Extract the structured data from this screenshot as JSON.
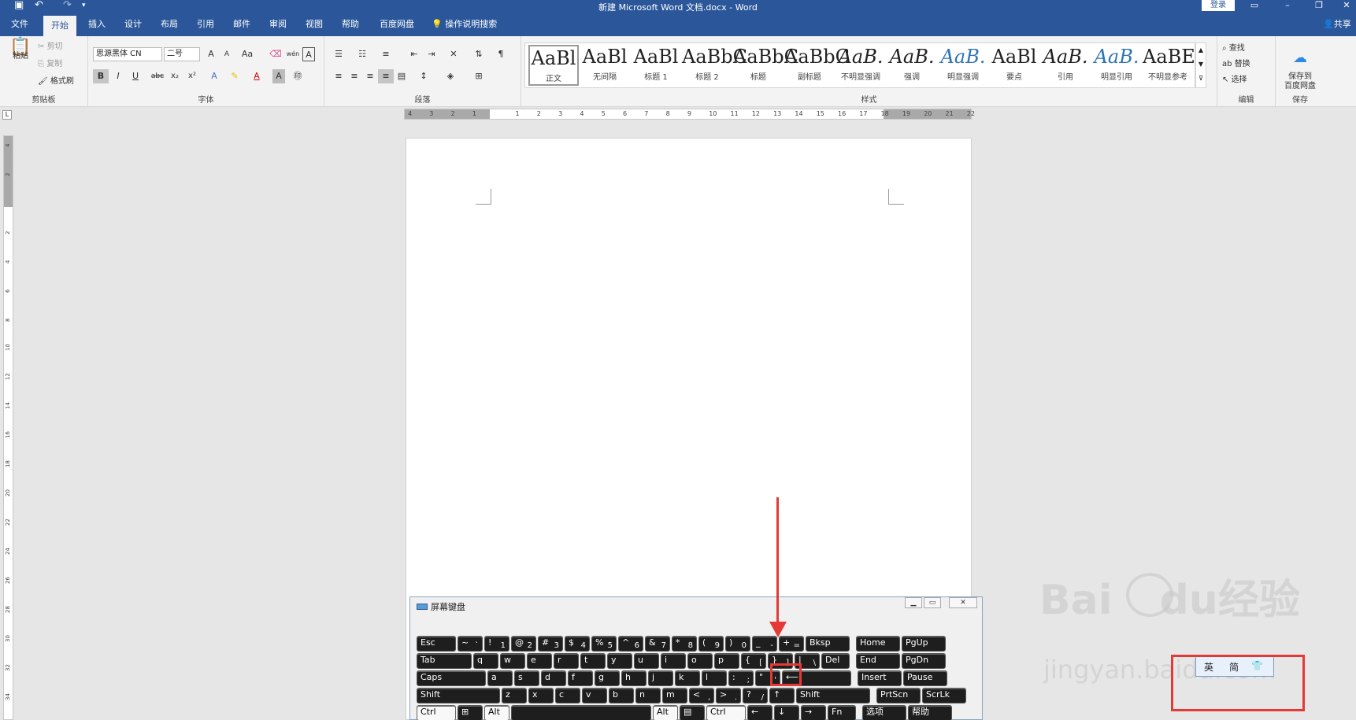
{
  "titlebar": {
    "title": "新建 Microsoft Word 文档.docx  -  Word",
    "login": "登录",
    "qat_icons": [
      "save-icon",
      "undo-icon",
      "redo-icon",
      "customize-icon"
    ]
  },
  "tabs": [
    {
      "label": "文件",
      "active": false
    },
    {
      "label": "开始",
      "active": true
    },
    {
      "label": "插入",
      "active": false
    },
    {
      "label": "设计",
      "active": false
    },
    {
      "label": "布局",
      "active": false
    },
    {
      "label": "引用",
      "active": false
    },
    {
      "label": "邮件",
      "active": false
    },
    {
      "label": "审阅",
      "active": false
    },
    {
      "label": "视图",
      "active": false
    },
    {
      "label": "帮助",
      "active": false
    },
    {
      "label": "百度网盘",
      "active": false
    }
  ],
  "tellme": "操作说明搜索",
  "share": "共享",
  "ribbon": {
    "clipboard": {
      "paste": "粘贴",
      "cut": "剪切",
      "copy": "复制",
      "format_painter": "格式刷",
      "label": "剪贴板"
    },
    "font": {
      "name": "思源黑体 CN",
      "size": "二号",
      "label": "字体",
      "bold": "B",
      "italic": "I",
      "underline": "U",
      "strike": "abc",
      "sub": "x₂",
      "sup": "x²",
      "change_case": "Aa",
      "phonetic": "wén",
      "grow": "A",
      "shrink": "A"
    },
    "paragraph": {
      "label": "段落"
    },
    "styles": {
      "label": "样式",
      "items": [
        {
          "sample": "AaBl",
          "name": "正文",
          "selected": true,
          "variant": "normal"
        },
        {
          "sample": "AaBl",
          "name": "无间隔",
          "selected": false,
          "variant": "normal"
        },
        {
          "sample": "AaBl",
          "name": "标题 1",
          "selected": false,
          "variant": "normal"
        },
        {
          "sample": "AaBbC",
          "name": "标题 2",
          "selected": false,
          "variant": "normal"
        },
        {
          "sample": "AaBbC",
          "name": "标题",
          "selected": false,
          "variant": "normal"
        },
        {
          "sample": "AaBbC",
          "name": "副标题",
          "selected": false,
          "variant": "normal"
        },
        {
          "sample": "AaB.",
          "name": "不明显强调",
          "selected": false,
          "variant": "ital"
        },
        {
          "sample": "AaB.",
          "name": "强调",
          "selected": false,
          "variant": "ital"
        },
        {
          "sample": "AaB.",
          "name": "明显强调",
          "selected": false,
          "variant": "blue"
        },
        {
          "sample": "AaBl",
          "name": "要点",
          "selected": false,
          "variant": "normal"
        },
        {
          "sample": "AaB.",
          "name": "引用",
          "selected": false,
          "variant": "ital"
        },
        {
          "sample": "AaB.",
          "name": "明显引用",
          "selected": false,
          "variant": "blue"
        },
        {
          "sample": "AaBE",
          "name": "不明显参考",
          "selected": false,
          "variant": "normal"
        }
      ]
    },
    "editing": {
      "find": "查找",
      "replace": "替换",
      "select": "选择",
      "label": "编辑"
    },
    "save": {
      "button": "保存到\n百度网盘",
      "label": "保存"
    }
  },
  "ruler": {
    "h_ticks": [
      "4",
      "3",
      "2",
      "1",
      "",
      "1",
      "2",
      "3",
      "4",
      "5",
      "6",
      "7",
      "8",
      "9",
      "10",
      "11",
      "12",
      "13",
      "14",
      "15",
      "16",
      "17",
      "18",
      "19",
      "20",
      "21",
      "22"
    ],
    "v_ticks": [
      "4",
      "2",
      "",
      "2",
      "4",
      "6",
      "8",
      "10",
      "12",
      "14",
      "16",
      "18",
      "20",
      "22",
      "24",
      "26",
      "28",
      "30",
      "32",
      "34"
    ]
  },
  "osk": {
    "title": "屏幕键盘",
    "rows": [
      [
        {
          "m": "Esc"
        },
        {
          "t": "~",
          "m": "`"
        },
        {
          "t": "!",
          "m": "1"
        },
        {
          "t": "@",
          "m": "2"
        },
        {
          "t": "#",
          "m": "3"
        },
        {
          "t": "$",
          "m": "4"
        },
        {
          "t": "%",
          "m": "5"
        },
        {
          "t": "^",
          "m": "6"
        },
        {
          "t": "&",
          "m": "7"
        },
        {
          "t": "*",
          "m": "8"
        },
        {
          "t": "(",
          "m": "9"
        },
        {
          "t": ")",
          "m": "0"
        },
        {
          "t": "_",
          "m": "-"
        },
        {
          "t": "+",
          "m": "="
        },
        {
          "m": "Bksp"
        },
        {
          "m": "Home"
        },
        {
          "m": "PgUp"
        }
      ],
      [
        {
          "m": "Tab"
        },
        {
          "m": "q"
        },
        {
          "m": "w"
        },
        {
          "m": "e"
        },
        {
          "m": "r"
        },
        {
          "m": "t"
        },
        {
          "m": "y"
        },
        {
          "m": "u"
        },
        {
          "m": "i"
        },
        {
          "m": "o"
        },
        {
          "m": "p"
        },
        {
          "t": "{",
          "m": "["
        },
        {
          "t": "}",
          "m": "]"
        },
        {
          "t": "|",
          "m": "\\"
        },
        {
          "m": "Del"
        },
        {
          "m": "End"
        },
        {
          "m": "PgDn"
        }
      ],
      [
        {
          "m": "Caps"
        },
        {
          "m": "a"
        },
        {
          "m": "s"
        },
        {
          "m": "d"
        },
        {
          "m": "f"
        },
        {
          "m": "g"
        },
        {
          "m": "h"
        },
        {
          "m": "j"
        },
        {
          "m": "k"
        },
        {
          "m": "l"
        },
        {
          "t": ":",
          "m": ";"
        },
        {
          "t": "\"",
          "m": "'"
        },
        {
          "m": "⟵"
        },
        {
          "m": "Insert"
        },
        {
          "m": "Pause"
        }
      ],
      [
        {
          "m": "Shift"
        },
        {
          "m": "z"
        },
        {
          "m": "x"
        },
        {
          "m": "c"
        },
        {
          "m": "v"
        },
        {
          "m": "b"
        },
        {
          "m": "n"
        },
        {
          "m": "m"
        },
        {
          "t": "<",
          "m": ","
        },
        {
          "t": ">",
          "m": "."
        },
        {
          "t": "?",
          "m": "/"
        },
        {
          "m": "↑"
        },
        {
          "m": "Shift"
        },
        {
          "m": "PrtScn"
        },
        {
          "m": "ScrLk"
        }
      ],
      [
        {
          "m": "Ctrl"
        },
        {
          "m": "⊞"
        },
        {
          "m": "Alt"
        },
        {
          "m": ""
        },
        {
          "m": "Alt"
        },
        {
          "m": "▤"
        },
        {
          "m": "Ctrl"
        },
        {
          "m": "←"
        },
        {
          "m": "↓"
        },
        {
          "m": "→"
        },
        {
          "m": "Fn"
        },
        {
          "m": "选项"
        },
        {
          "m": "帮助"
        }
      ]
    ]
  },
  "ime": {
    "lang": "英",
    "mode": "简",
    "icon": "shirt-icon"
  },
  "watermark": {
    "brand": "Bai",
    "brand2": "du",
    "cn": "经验",
    "url": "jingyan.baidu.com"
  },
  "colors": {
    "accent": "#2b579a",
    "highlight": "#e53935"
  }
}
